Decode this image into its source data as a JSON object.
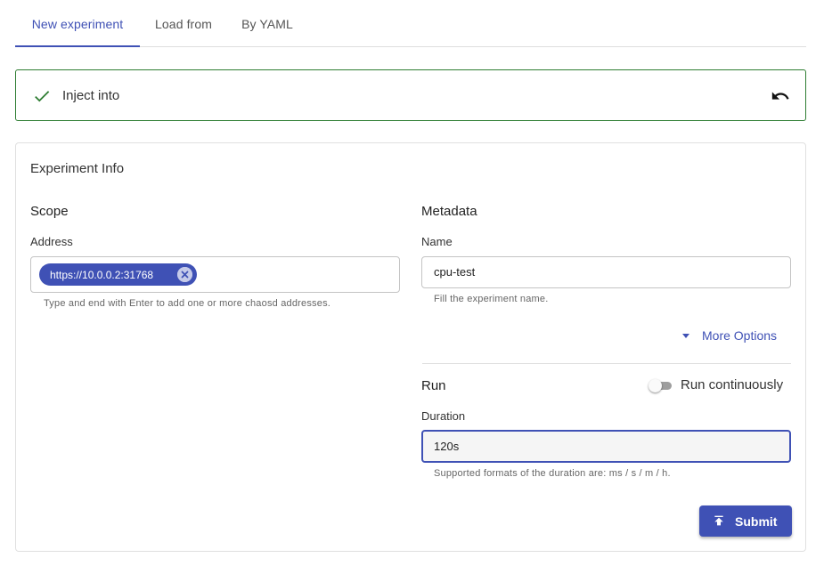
{
  "tabs": [
    {
      "label": "New experiment",
      "active": true
    },
    {
      "label": "Load from",
      "active": false
    },
    {
      "label": "By YAML",
      "active": false
    }
  ],
  "inject": {
    "label": "Inject into",
    "icons": {
      "status": "check-icon",
      "action": "undo-icon"
    },
    "status_color": "#2e7d32"
  },
  "card": {
    "title": "Experiment Info",
    "scope": {
      "title": "Scope",
      "address_label": "Address",
      "chips": [
        "https://10.0.0.2:31768"
      ],
      "address_helper": "Type and end with Enter to add one or more chaosd addresses."
    },
    "metadata": {
      "title": "Metadata",
      "name_label": "Name",
      "name_value": "cpu-test",
      "name_helper": "Fill the experiment name.",
      "more_options": "More Options"
    },
    "run": {
      "title": "Run",
      "continuous_label": "Run continuously",
      "continuous_on": false,
      "duration_label": "Duration",
      "duration_value": "120s",
      "duration_helper": "Supported formats of the duration are: ms / s / m / h."
    },
    "submit_label": "Submit"
  },
  "colors": {
    "primary": "#3f51b5",
    "success": "#2e7d32"
  }
}
